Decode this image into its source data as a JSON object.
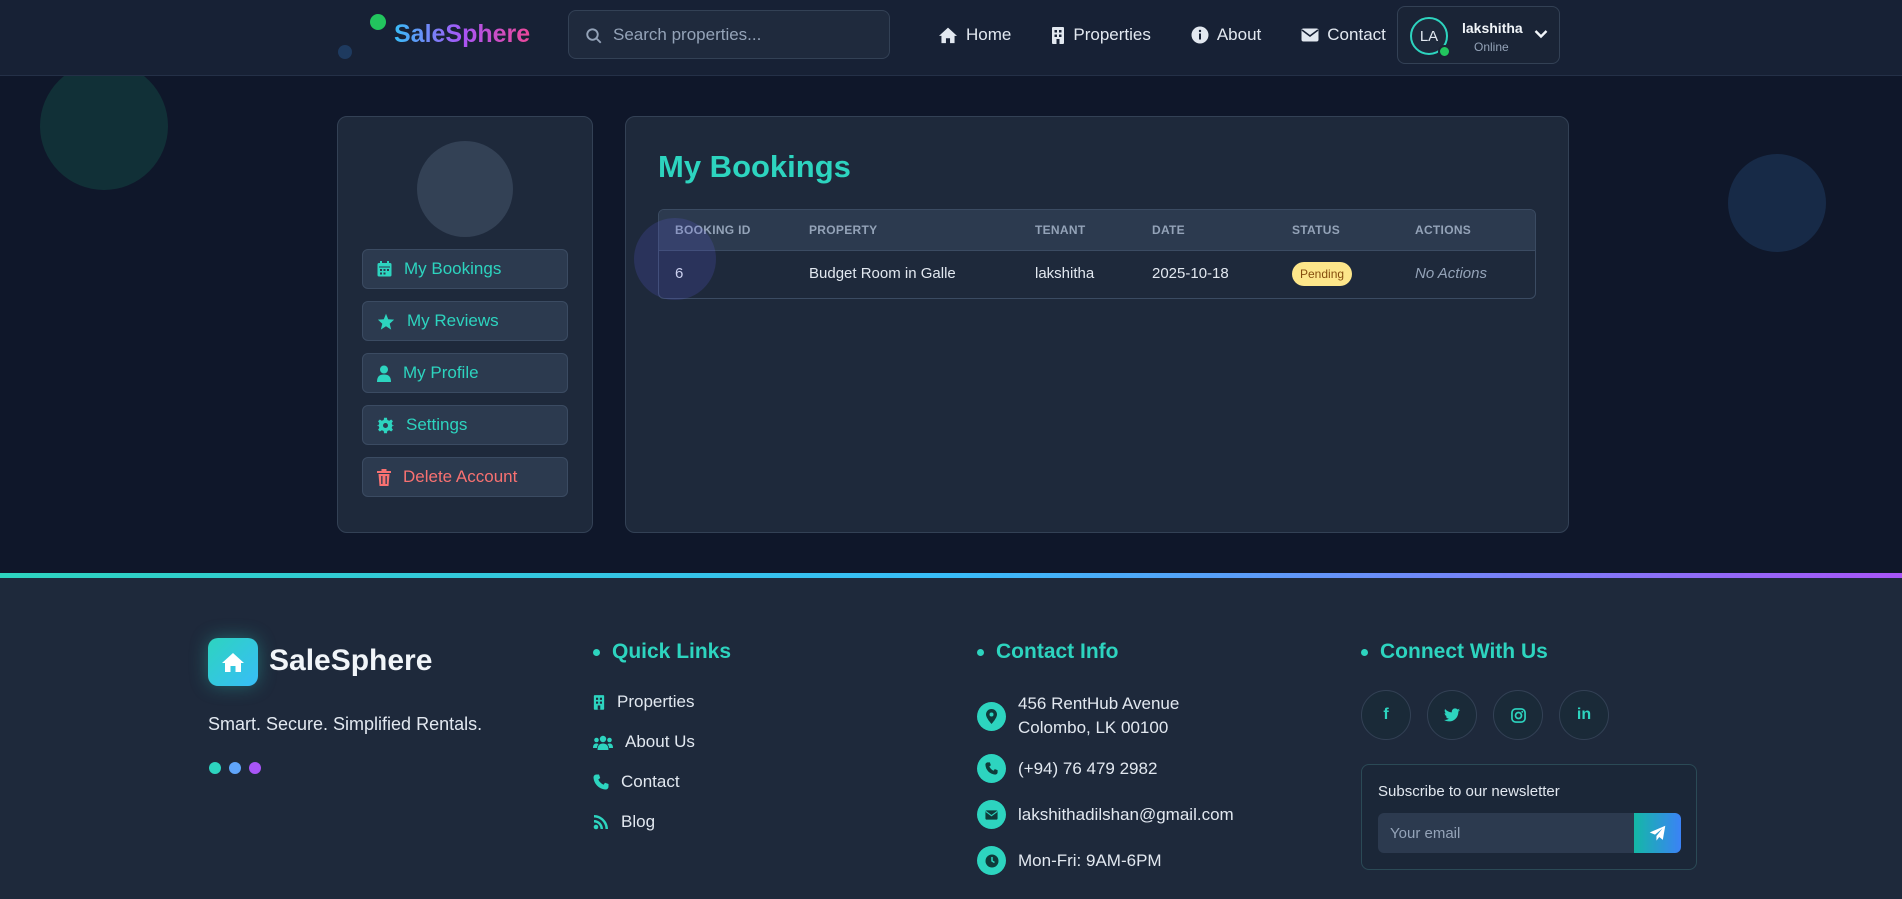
{
  "header": {
    "brand": "SaleSphere",
    "search_placeholder": "Search properties...",
    "nav": [
      {
        "label": "Home",
        "icon": "home-icon"
      },
      {
        "label": "Properties",
        "icon": "building-icon"
      },
      {
        "label": "About",
        "icon": "info-icon"
      },
      {
        "label": "Contact",
        "icon": "envelope-icon"
      }
    ],
    "user": {
      "initials": "LA",
      "name": "lakshitha",
      "status": "Online"
    }
  },
  "sidebar": {
    "items": [
      {
        "label": "My Bookings",
        "icon": "calendar-icon"
      },
      {
        "label": "My Reviews",
        "icon": "star-icon"
      },
      {
        "label": "My Profile",
        "icon": "user-icon"
      },
      {
        "label": "Settings",
        "icon": "gear-icon"
      },
      {
        "label": "Delete Account",
        "icon": "trash-icon"
      }
    ]
  },
  "main": {
    "title": "My Bookings",
    "columns": [
      "BOOKING ID",
      "PROPERTY",
      "TENANT",
      "DATE",
      "STATUS",
      "ACTIONS"
    ],
    "rows": [
      {
        "id": "6",
        "property": "Budget Room in Galle",
        "tenant": "lakshitha",
        "date": "2025-10-18",
        "status": "Pending",
        "actions": "No Actions"
      }
    ]
  },
  "footer": {
    "brand": "SaleSphere",
    "tagline": "Smart. Secure. Simplified Rentals.",
    "quick_links_title": "Quick Links",
    "quick_links": [
      {
        "label": "Properties",
        "icon": "building-icon"
      },
      {
        "label": "About Us",
        "icon": "users-icon"
      },
      {
        "label": "Contact",
        "icon": "phone-icon"
      },
      {
        "label": "Blog",
        "icon": "blog-icon"
      }
    ],
    "contact_title": "Contact Info",
    "contact": {
      "address_line1": "456 RentHub Avenue",
      "address_line2": "Colombo, LK 00100",
      "phone": "(+94) 76 479 2982",
      "email": "lakshithadilshan@gmail.com",
      "hours": "Mon-Fri: 9AM-6PM"
    },
    "connect_title": "Connect With Us",
    "social": [
      {
        "label": "f",
        "icon": "facebook-icon"
      },
      {
        "label": "twitter",
        "icon": "twitter-icon"
      },
      {
        "label": "instagram",
        "icon": "instagram-icon"
      },
      {
        "label": "in",
        "icon": "linkedin-icon"
      }
    ],
    "newsletter": {
      "title": "Subscribe to our newsletter",
      "placeholder": "Your email"
    }
  },
  "colors": {
    "accent": "#2dd4bf",
    "danger": "#f87171",
    "pending_badge": "#fde68a",
    "background": "#0f172a"
  }
}
